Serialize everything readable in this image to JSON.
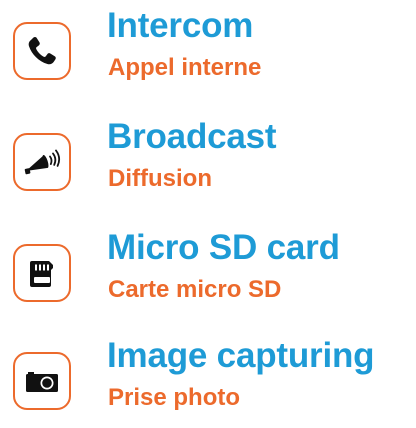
{
  "colors": {
    "title": "#1e9bd6",
    "subtitle": "#ec6a2c",
    "icon_border": "#ec6a2c",
    "icon_fill": "#111111"
  },
  "features": [
    {
      "icon": "phone-icon",
      "title": "Intercom",
      "subtitle": "Appel interne"
    },
    {
      "icon": "megaphone-icon",
      "title": "Broadcast",
      "subtitle": "Diffusion"
    },
    {
      "icon": "sd-card-icon",
      "title": "Micro SD card",
      "subtitle": "Carte micro SD"
    },
    {
      "icon": "camera-icon",
      "title": "Image capturing",
      "subtitle": "Prise photo"
    }
  ]
}
